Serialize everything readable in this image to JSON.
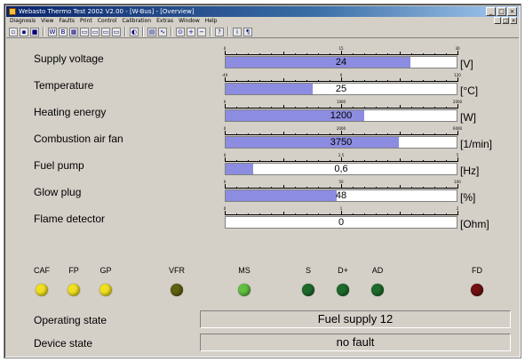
{
  "window": {
    "title": "Webasto Thermo Test 2002 V2.00 - [W-Bus] - [Overview]",
    "controls": [
      "_",
      "□",
      "×"
    ],
    "mdi_controls": [
      "_",
      "□",
      "×"
    ]
  },
  "menu": [
    "Diagnosis",
    "View",
    "Faults",
    "Print",
    "Control",
    "Calibration",
    "Extras",
    "Window",
    "Help"
  ],
  "toolbar_icons": [
    "new-icon",
    "open-icon",
    "stop-icon",
    "sep",
    "wbus-icon",
    "wbus2-icon",
    "grid-icon",
    "panel1-icon",
    "panel2-icon",
    "panel3-icon",
    "panel4-icon",
    "sep",
    "meter-icon",
    "sep",
    "print-icon",
    "graph-icon",
    "sep",
    "zoom-icon",
    "zoom-in-icon",
    "zoom-out-icon",
    "sep",
    "help-icon",
    "sep",
    "info-icon",
    "about-icon"
  ],
  "gauges": [
    {
      "label": "Supply voltage",
      "value": "24",
      "unit": "[V]",
      "scale": [
        "0",
        "15",
        "30"
      ],
      "fraction": 0.8
    },
    {
      "label": "Temperature",
      "value": "25",
      "unit": "[°C]",
      "scale": [
        "-40",
        "0",
        "120"
      ],
      "fraction": 0.375
    },
    {
      "label": "Heating energy",
      "value": "1200",
      "unit": "[W]",
      "scale": [
        "0",
        "1000",
        "2000"
      ],
      "fraction": 0.6
    },
    {
      "label": "Combustion air fan",
      "value": "3750",
      "unit": "[1/min]",
      "scale": [
        "0",
        "2000",
        "6000"
      ],
      "fraction": 0.75
    },
    {
      "label": "Fuel pump",
      "value": "0,6",
      "unit": "[Hz]",
      "scale": [
        "0",
        "2,5",
        "5"
      ],
      "fraction": 0.12
    },
    {
      "label": "Glow plug",
      "value": "48",
      "unit": "[%]",
      "scale": [
        "0",
        "50",
        "100"
      ],
      "fraction": 0.48
    },
    {
      "label": "Flame detector",
      "value": "0",
      "unit": "[Ohm]",
      "scale": [
        "0",
        "1",
        "2"
      ],
      "fraction": 0.0
    }
  ],
  "indicators": [
    {
      "label": "CAF",
      "color": "#f0e020"
    },
    {
      "label": "FP",
      "color": "#f0e020"
    },
    {
      "label": "GP",
      "color": "#f0e020"
    },
    {
      "label": "VFR",
      "color": "#606010"
    },
    {
      "label": "MS",
      "color": "#60c040"
    },
    {
      "label": "S",
      "color": "#1e6a2c"
    },
    {
      "label": "D+",
      "color": "#1e6a2c"
    },
    {
      "label": "AD",
      "color": "#1e6a2c"
    },
    {
      "label": "FD",
      "color": "#701010"
    }
  ],
  "status": {
    "operating_state_label": "Operating state",
    "operating_state_value": "Fuel supply 12",
    "device_state_label": "Device state",
    "device_state_value": "no fault"
  },
  "colors": {
    "bar_fill": "#8c8ce0",
    "window_bg": "#d4d0c8",
    "titlebar": "#0a246a"
  }
}
